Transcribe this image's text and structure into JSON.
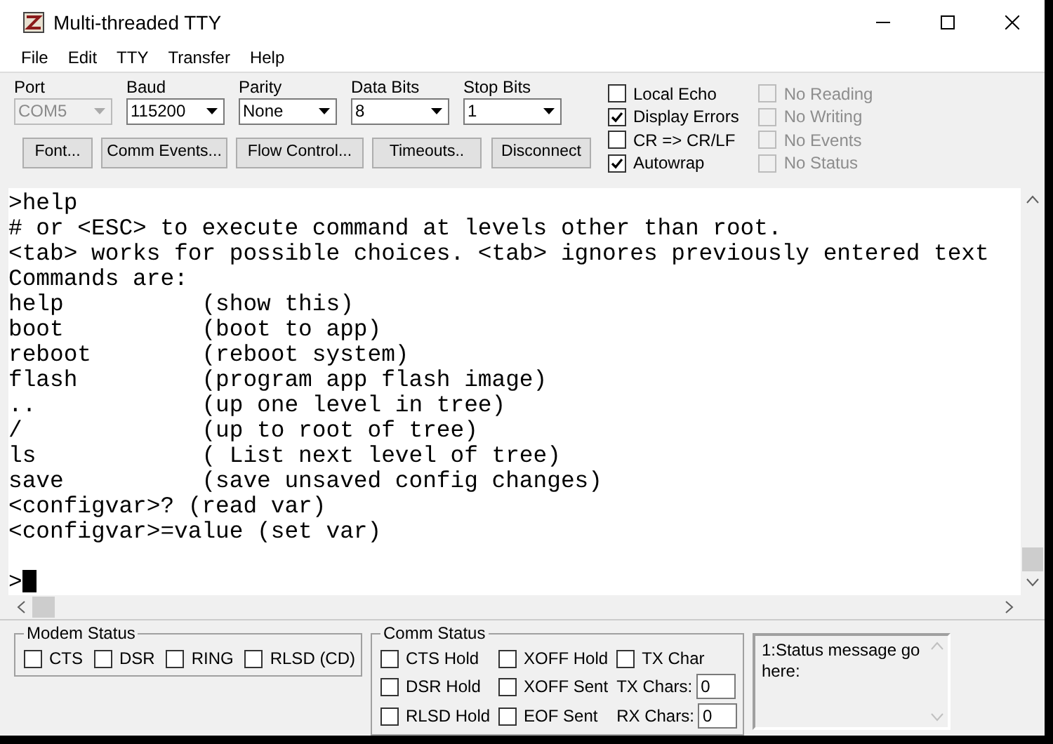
{
  "window": {
    "title": "Multi-threaded TTY"
  },
  "menu": [
    "File",
    "Edit",
    "TTY",
    "Transfer",
    "Help"
  ],
  "settings": [
    {
      "label": "Port",
      "value": "COM5",
      "disabled": true
    },
    {
      "label": "Baud",
      "value": "115200",
      "disabled": false
    },
    {
      "label": "Parity",
      "value": "None",
      "disabled": false
    },
    {
      "label": "Data Bits",
      "value": "8",
      "disabled": false
    },
    {
      "label": "Stop Bits",
      "value": "1",
      "disabled": false
    }
  ],
  "buttons": [
    "Font...",
    "Comm Events...",
    "Flow Control...",
    "Timeouts..",
    "Disconnect"
  ],
  "options": [
    {
      "label": "Local Echo",
      "checked": false,
      "disabled": false
    },
    {
      "label": "Display Errors",
      "checked": true,
      "disabled": false
    },
    {
      "label": "CR => CR/LF",
      "checked": false,
      "disabled": false
    },
    {
      "label": "Autowrap",
      "checked": true,
      "disabled": false
    }
  ],
  "event_options": [
    {
      "label": "No Reading",
      "checked": false,
      "disabled": true
    },
    {
      "label": "No Writing",
      "checked": false,
      "disabled": true
    },
    {
      "label": "No Events",
      "checked": false,
      "disabled": true
    },
    {
      "label": "No Status",
      "checked": false,
      "disabled": true
    }
  ],
  "terminal": {
    "lines": [
      ">help",
      "# or <ESC> to execute command at levels other than root.",
      "<tab> works for possible choices. <tab> ignores previously entered text",
      "Commands are:",
      "help          (show this)",
      "boot          (boot to app)",
      "reboot        (reboot system)",
      "flash         (program app flash image)",
      "..            (up one level in tree)",
      "/             (up to root of tree)",
      "ls            ( List next level of tree)",
      "save          (save unsaved config changes)",
      "<configvar>? (read var)",
      "<configvar>=value (set var)"
    ],
    "prompt": ">"
  },
  "modem_status": {
    "title": "Modem Status",
    "signals": [
      {
        "label": "CTS",
        "checked": false
      },
      {
        "label": "DSR",
        "checked": false
      },
      {
        "label": "RING",
        "checked": false
      },
      {
        "label": "RLSD (CD)",
        "checked": false
      }
    ]
  },
  "comm_status": {
    "title": "Comm Status",
    "flags": [
      {
        "label": "CTS Hold",
        "checked": false
      },
      {
        "label": "XOFF Hold",
        "checked": false
      },
      {
        "label": "TX Char",
        "checked": false
      },
      {
        "label": "DSR Hold",
        "checked": false
      },
      {
        "label": "XOFF Sent",
        "checked": false
      },
      {
        "label": "RLSD Hold",
        "checked": false
      },
      {
        "label": "EOF Sent",
        "checked": false
      }
    ],
    "counters": [
      {
        "label": "TX Chars:",
        "value": "0"
      },
      {
        "label": "RX Chars:",
        "value": "0"
      }
    ]
  },
  "status_message": "1:Status message go here:"
}
